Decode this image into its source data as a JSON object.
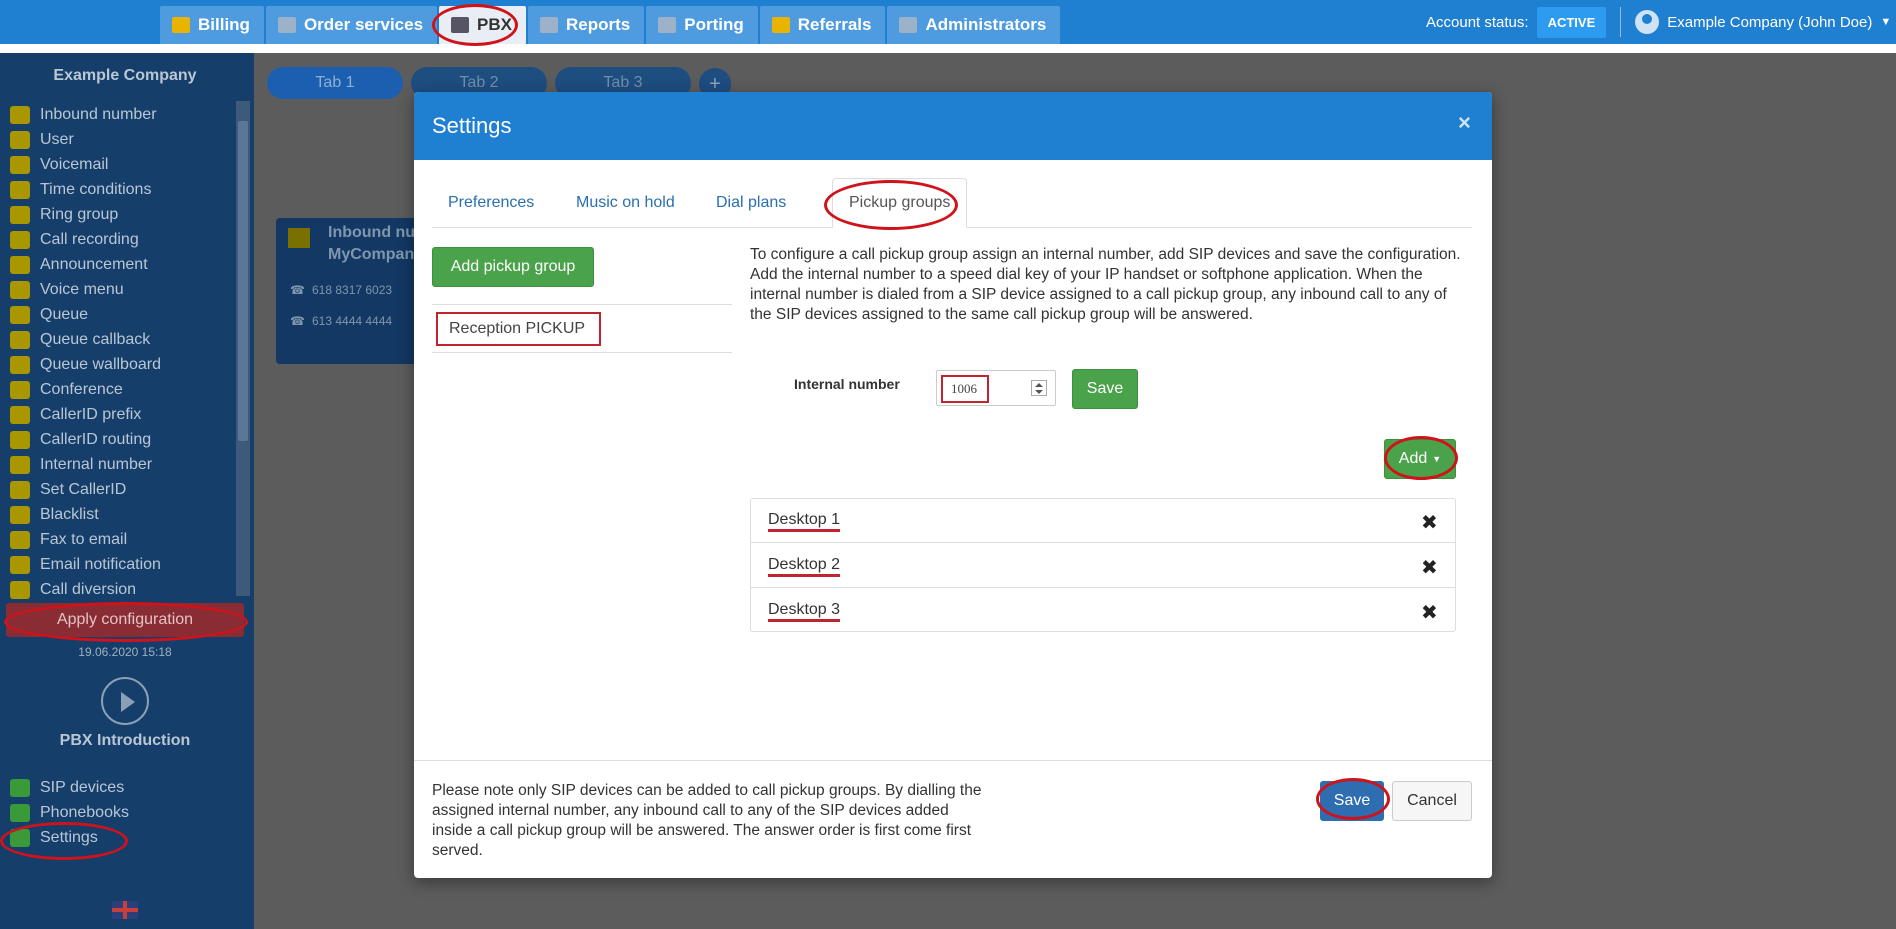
{
  "topnav": {
    "items": [
      {
        "label": "Billing",
        "icon": "coins-icon"
      },
      {
        "label": "Order services",
        "icon": "cart-icon"
      },
      {
        "label": "PBX",
        "icon": "pbx-icon"
      },
      {
        "label": "Reports",
        "icon": "report-icon"
      },
      {
        "label": "Porting",
        "icon": "phone-icon"
      },
      {
        "label": "Referrals",
        "icon": "user-icon"
      },
      {
        "label": "Administrators",
        "icon": "admin-icon"
      }
    ],
    "account_status_label": "Account status:",
    "account_status_value": "ACTIVE",
    "user": "Example Company (John Doe)"
  },
  "sidebar": {
    "company": "Example Company",
    "items": [
      "Inbound number",
      "User",
      "Voicemail",
      "Time conditions",
      "Ring group",
      "Call recording",
      "Announcement",
      "Voice menu",
      "Queue",
      "Queue callback",
      "Queue wallboard",
      "Conference",
      "CallerID prefix",
      "CallerID routing",
      "Internal number",
      "Set CallerID",
      "Blacklist",
      "Fax to email",
      "Email notification",
      "Call diversion"
    ],
    "apply_label": "Apply configuration",
    "apply_date": "19.06.2020 15:18",
    "intro_label": "PBX Introduction",
    "bottom_items": [
      "SIP devices",
      "Phonebooks",
      "Settings"
    ]
  },
  "background": {
    "tabs": [
      "Tab 1",
      "Tab 2",
      "Tab 3"
    ],
    "card_title_1": "Inbound nu",
    "card_title_2": "MyCompany",
    "card_numbers": [
      "618 8317 6023",
      "613 4444 4444"
    ]
  },
  "modal": {
    "title": "Settings",
    "close": "×",
    "tabs": [
      "Preferences",
      "Music on hold",
      "Dial plans",
      "Pickup groups"
    ],
    "add_group_label": "Add pickup group",
    "group_item": "Reception PICKUP",
    "description": "To configure a call pickup group assign an internal number, add SIP devices and save the configuration. Add the internal number to a speed dial key of your IP handset or softphone application. When the internal number is dialed from a SIP device assigned to a call pickup group, any inbound call to any of the SIP devices assigned to the same call pickup group will be answered.",
    "internal_number_label": "Internal number",
    "internal_number_value": "1006",
    "save_label": "Save",
    "add_label": "Add",
    "devices": [
      "Desktop 1",
      "Desktop 2",
      "Desktop 3"
    ],
    "remove_glyph": "✖",
    "footer_note": "Please note only SIP devices can be added to call pickup groups. By dialling the assigned internal number, any inbound call to any of the SIP devices added inside a call pickup group will be answered. The answer order is first come first served.",
    "footer_save": "Save",
    "footer_cancel": "Cancel"
  },
  "colors": {
    "header_blue": "#1f7fd0",
    "sidebar_navy": "#163e6a",
    "success_green": "#4aa34a",
    "annotation_red": "#d0121b"
  }
}
